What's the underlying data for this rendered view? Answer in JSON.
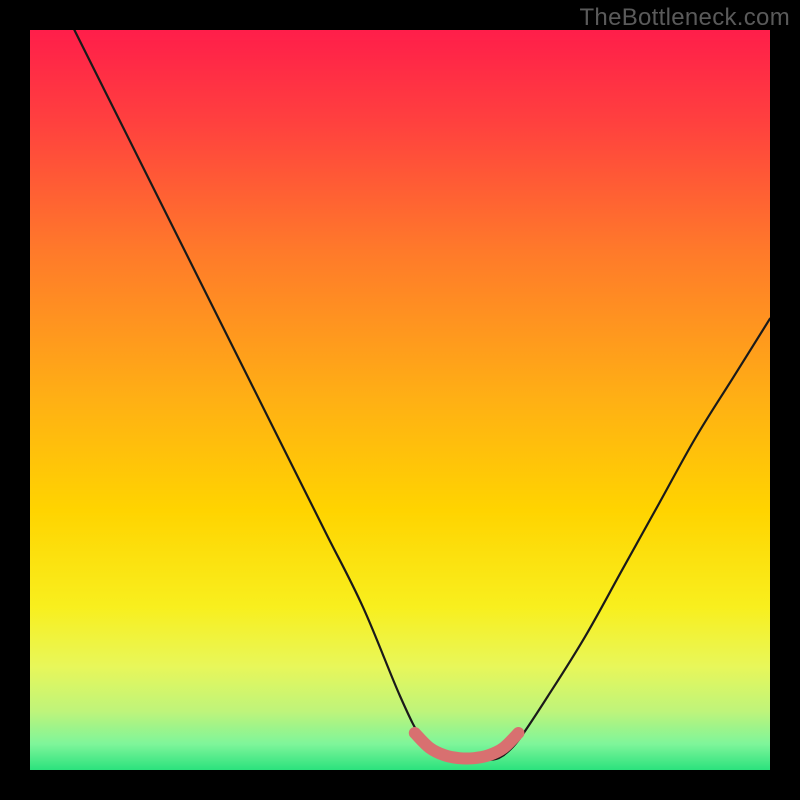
{
  "watermark": "TheBottleneck.com",
  "colors": {
    "frame": "#000000",
    "watermark": "#5a5a5a",
    "curve": "#1a1a1a",
    "highlight": "#d87070",
    "gradient_stops": [
      {
        "offset": 0.0,
        "color": "#ff1e4a"
      },
      {
        "offset": 0.12,
        "color": "#ff3f3f"
      },
      {
        "offset": 0.3,
        "color": "#ff7a2a"
      },
      {
        "offset": 0.5,
        "color": "#ffb014"
      },
      {
        "offset": 0.65,
        "color": "#ffd400"
      },
      {
        "offset": 0.78,
        "color": "#f8ef1e"
      },
      {
        "offset": 0.86,
        "color": "#e8f75a"
      },
      {
        "offset": 0.92,
        "color": "#bff47a"
      },
      {
        "offset": 0.965,
        "color": "#7ef59a"
      },
      {
        "offset": 1.0,
        "color": "#2be27d"
      }
    ]
  },
  "chart_data": {
    "type": "line",
    "title": "",
    "xlabel": "",
    "ylabel": "",
    "xlim": [
      0,
      100
    ],
    "ylim": [
      0,
      100
    ],
    "series": [
      {
        "name": "left-curve",
        "x": [
          6,
          10,
          15,
          20,
          25,
          30,
          35,
          40,
          45,
          50,
          53,
          55
        ],
        "y": [
          100,
          92,
          82,
          72,
          62,
          52,
          42,
          32,
          22,
          10,
          4,
          2
        ]
      },
      {
        "name": "right-curve",
        "x": [
          64,
          66,
          70,
          75,
          80,
          85,
          90,
          95,
          100
        ],
        "y": [
          2,
          4,
          10,
          18,
          27,
          36,
          45,
          53,
          61
        ]
      },
      {
        "name": "flat-bottom",
        "x": [
          55,
          57,
          59,
          61,
          63,
          64
        ],
        "y": [
          2,
          1.5,
          1.3,
          1.3,
          1.5,
          2
        ]
      }
    ],
    "highlight_segment": {
      "x": [
        52,
        54,
        56,
        58,
        60,
        62,
        64,
        66
      ],
      "y": [
        5,
        3,
        2,
        1.6,
        1.6,
        2,
        3,
        5
      ]
    }
  }
}
